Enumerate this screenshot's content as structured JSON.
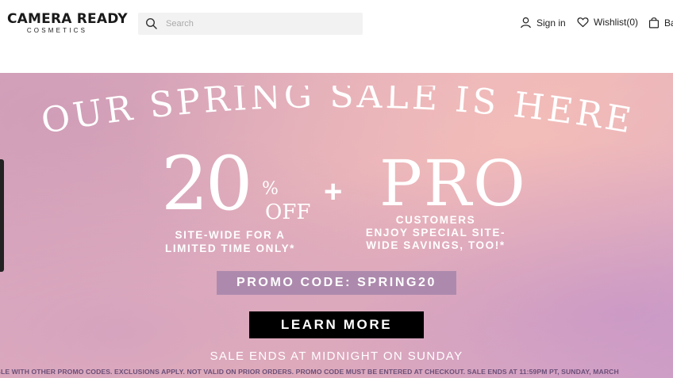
{
  "header": {
    "logo": {
      "main": "CAMERA READY",
      "sub": "COSMETICS"
    },
    "search": {
      "placeholder": "Search",
      "icon": "search-icon"
    },
    "links": {
      "signin": "Sign in",
      "wishlist": "Wishlist(0)",
      "bag": "Ba"
    }
  },
  "hero": {
    "headline": "OUR SPRING SALE IS HERE",
    "discount": {
      "number": "20",
      "percent": "%",
      "off": "OFF"
    },
    "plus": "+",
    "pro": "PRO",
    "left_sub": [
      "SITE-WIDE FOR A",
      "LIMITED TIME ONLY*"
    ],
    "right_sub": [
      "CUSTOMERS",
      "ENJOY SPECIAL SITE-",
      "WIDE SAVINGS, TOO!*"
    ],
    "promo_code": "PROMO CODE:  SPRING20",
    "cta": "LEARN MORE",
    "ends": "SALE ENDS AT MIDNIGHT ON SUNDAY",
    "disclaimer": "MBINABLE WITH OTHER PROMO CODES. EXCLUSIONS APPLY. NOT VALID ON PRIOR ORDERS. PROMO CODE MUST BE ENTERED AT CHECKOUT. SALE ENDS AT 11:59PM PT, SUNDAY, MARCH"
  },
  "colors": {
    "promo_bg": "#ad8aad",
    "cta_bg": "#000000",
    "disclaimer": "#6a4f78"
  }
}
